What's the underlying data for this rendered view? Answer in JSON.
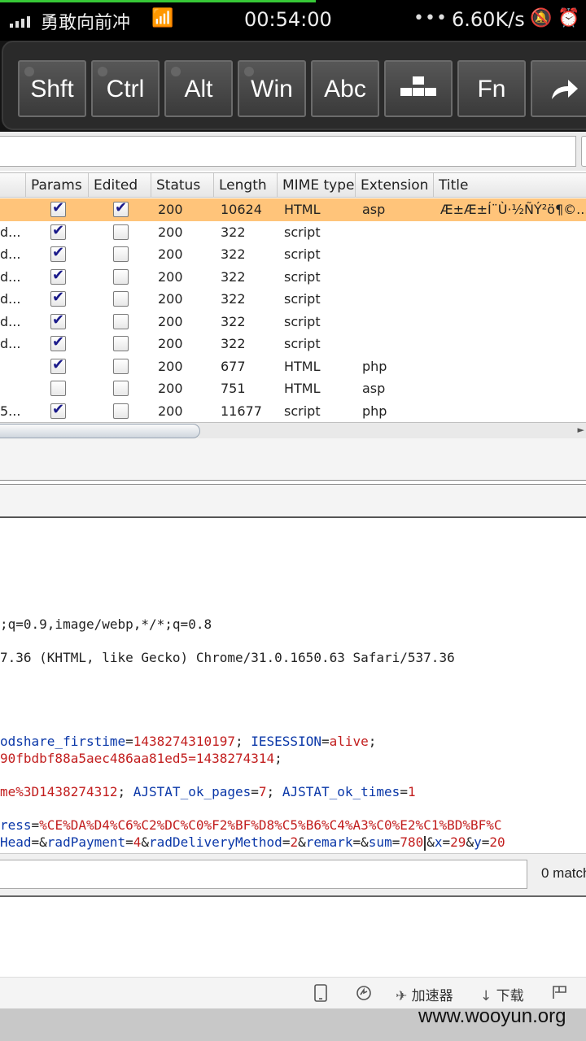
{
  "status_bar": {
    "carrier": "勇敢向前冲",
    "time": "00:54:00",
    "dots": "•••",
    "speed": "6.60K/s",
    "icons": [
      "signal-icon",
      "wifi-icon",
      "mute-icon",
      "alarm-icon"
    ]
  },
  "keys": [
    "Shft",
    "Ctrl",
    "Alt",
    "Win",
    "Abc",
    "",
    "Fn",
    ""
  ],
  "table": {
    "columns": [
      "Params",
      "Edited",
      "Status",
      "Length",
      "MIME type",
      "Extension",
      "Title"
    ],
    "rows": [
      {
        "host": "",
        "params": true,
        "edited": true,
        "status": "200",
        "length": "10624",
        "mime": "HTML",
        "ext": "asp",
        "title": "Æ±Æ±Í¨Ù·½ÑÝ²ö¶©...",
        "selected": true
      },
      {
        "host": "d...",
        "params": true,
        "edited": false,
        "status": "200",
        "length": "322",
        "mime": "script",
        "ext": "",
        "title": ""
      },
      {
        "host": "d...",
        "params": true,
        "edited": false,
        "status": "200",
        "length": "322",
        "mime": "script",
        "ext": "",
        "title": ""
      },
      {
        "host": "d...",
        "params": true,
        "edited": false,
        "status": "200",
        "length": "322",
        "mime": "script",
        "ext": "",
        "title": ""
      },
      {
        "host": "d...",
        "params": true,
        "edited": false,
        "status": "200",
        "length": "322",
        "mime": "script",
        "ext": "",
        "title": ""
      },
      {
        "host": "d...",
        "params": true,
        "edited": false,
        "status": "200",
        "length": "322",
        "mime": "script",
        "ext": "",
        "title": ""
      },
      {
        "host": "d...",
        "params": true,
        "edited": false,
        "status": "200",
        "length": "322",
        "mime": "script",
        "ext": "",
        "title": ""
      },
      {
        "host": "",
        "params": true,
        "edited": false,
        "status": "200",
        "length": "677",
        "mime": "HTML",
        "ext": "php",
        "title": ""
      },
      {
        "host": "",
        "params": false,
        "edited": false,
        "status": "200",
        "length": "751",
        "mime": "HTML",
        "ext": "asp",
        "title": ""
      },
      {
        "host": "5...",
        "params": true,
        "edited": false,
        "status": "200",
        "length": "11677",
        "mime": "script",
        "ext": "php",
        "title": ""
      }
    ]
  },
  "request": {
    "accept_tail": ";q=0.9,image/webp,*/*;q=0.8",
    "ua_tail": "7.36 (KHTML, like Gecko) Chrome/31.0.1650.63 Safari/537.36",
    "cookie1_k1": "odshare_firstime",
    "cookie1_v1": "1438274310197",
    "cookie1_k2": "IESESSION",
    "cookie1_v2": "alive",
    "cookie2_v": "90fbdbf88a5aec486aa81ed5=1438274314",
    "cookie3_k1": "me%3D1438274312",
    "cookie3_k2": "AJSTAT_ok_pages",
    "cookie3_v2": "7",
    "cookie3_k3": "AJSTAT_ok_times",
    "cookie3_v3": "1",
    "body1_k": "ress",
    "body1_v": "%CE%DA%D4%C6%C2%DC%C0%F2%BF%D8%C5%B6%C4%A3%C0%E2%C1%BD%BF%C",
    "body2_k1": "Head",
    "body2_k2": "radPayment",
    "body2_v2": "4",
    "body2_k3": "radDeliveryMethod",
    "body2_v3": "2",
    "body2_k4": "remark",
    "body2_k5": "sum",
    "body2_v5": "780",
    "body2_k6": "x",
    "body2_v6": "29",
    "body2_k7": "y",
    "body2_v7": "20"
  },
  "search": {
    "value": "",
    "matches": "0 match"
  },
  "bottom_bar": {
    "accelerator": "加速器",
    "download": "下载"
  },
  "watermark": "www.wooyun.org"
}
